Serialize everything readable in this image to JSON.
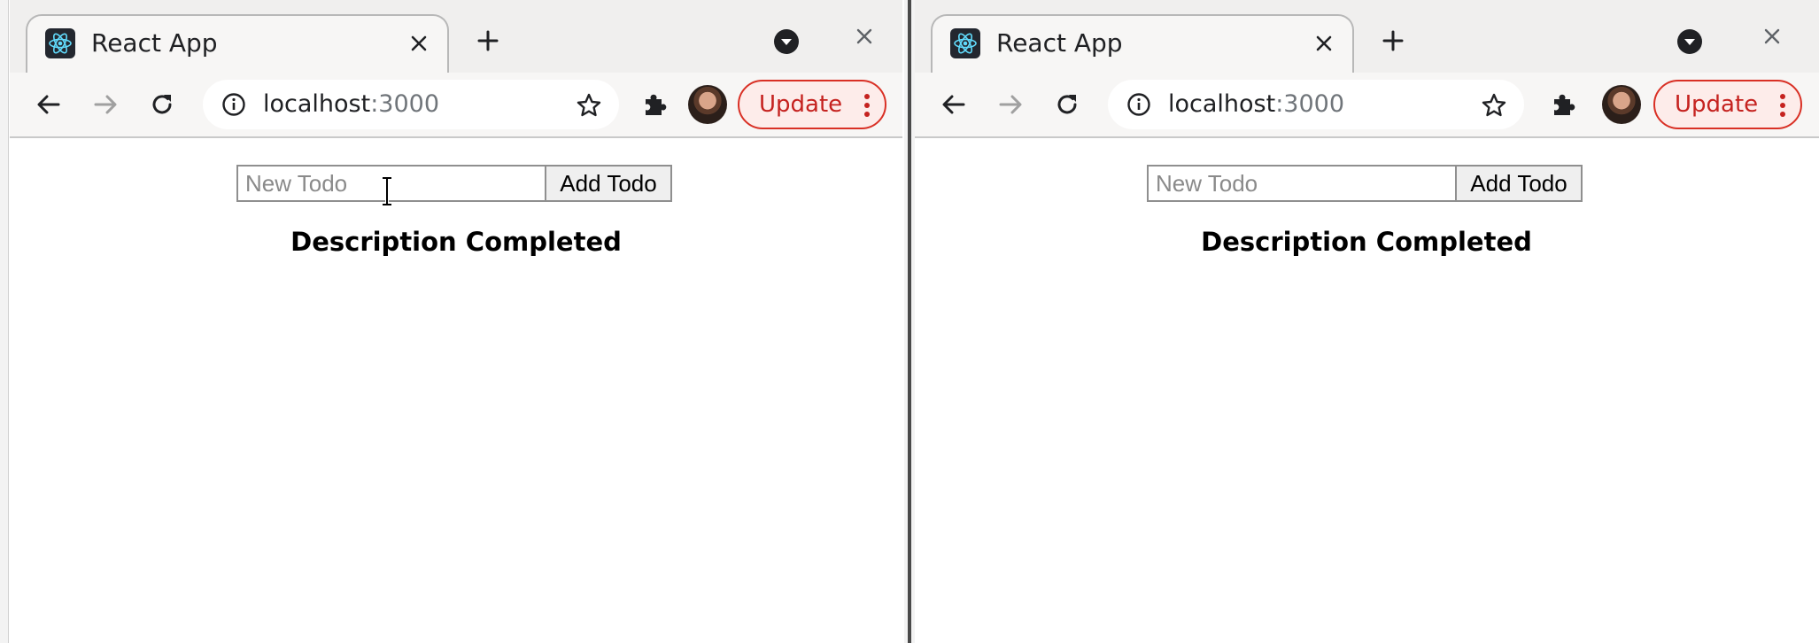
{
  "windows": [
    {
      "tab": {
        "title": "React App",
        "favicon": "react-logo-icon"
      },
      "address": {
        "host": "localhost",
        "port": ":3000"
      },
      "update_label": "Update",
      "todo": {
        "input_placeholder": "New Todo",
        "input_value": "",
        "add_button_label": "Add Todo"
      },
      "table": {
        "header": "Description Completed"
      }
    },
    {
      "tab": {
        "title": "React App",
        "favicon": "react-logo-icon"
      },
      "address": {
        "host": "localhost",
        "port": ":3000"
      },
      "update_label": "Update",
      "todo": {
        "input_placeholder": "New Todo",
        "input_value": "",
        "add_button_label": "Add Todo"
      },
      "table": {
        "header": "Description Completed"
      }
    }
  ],
  "colors": {
    "update_accent": "#d93025",
    "react_logo": "#61dafb",
    "tab_strip": "#f0efee"
  }
}
